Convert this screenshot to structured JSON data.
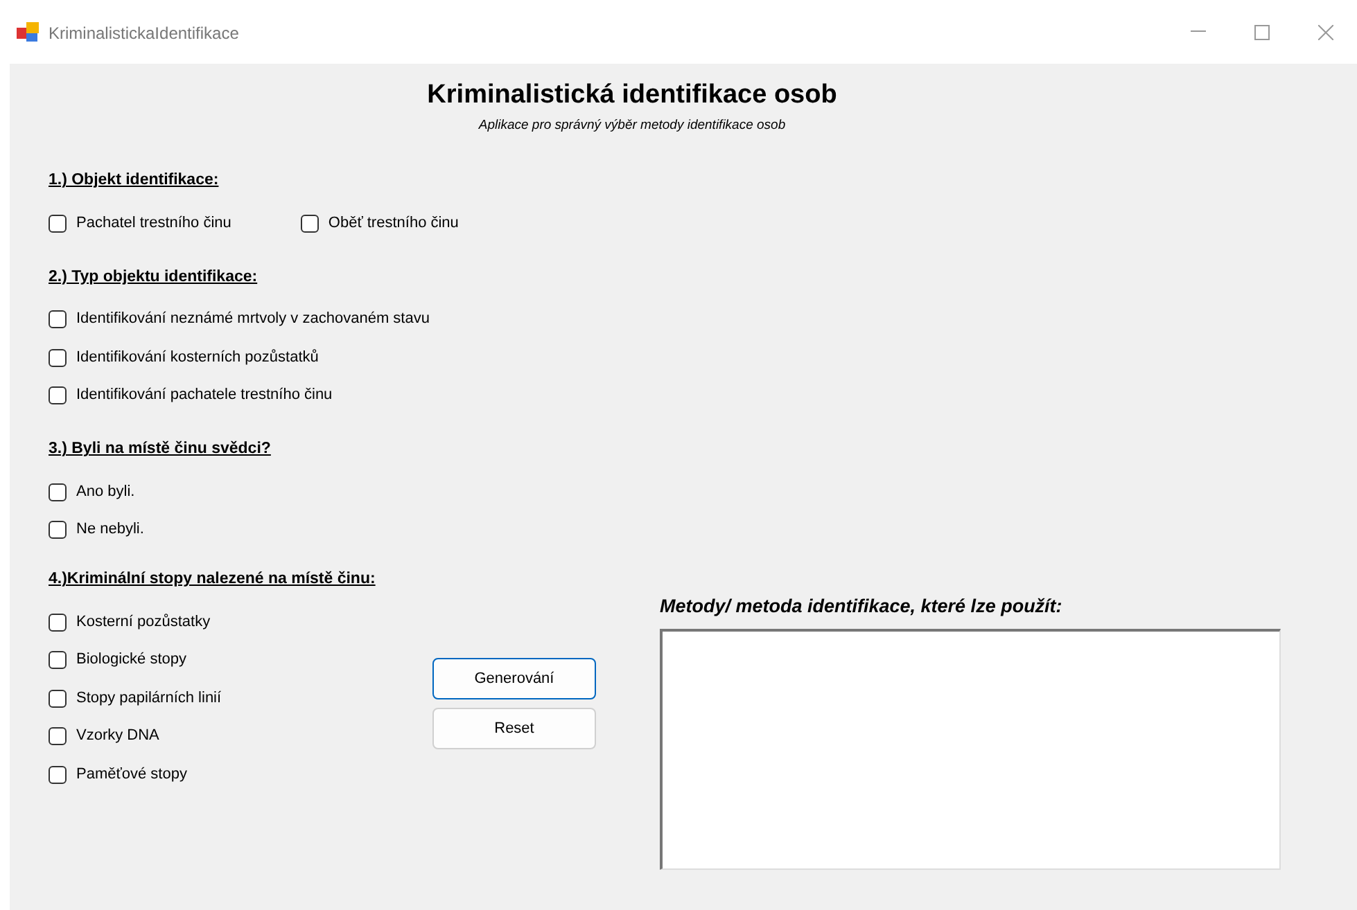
{
  "window": {
    "title": "KriminalistickaIdentifikace"
  },
  "heading": "Kriminalistická identifikace osob",
  "subtitle": "Aplikace pro správný výběr metody identifikace osob",
  "sections": [
    {
      "title": "1.) Objekt identifikace:",
      "kind": "row",
      "options": [
        {
          "label": "Pachatel trestního činu",
          "checked": false
        },
        {
          "label": "Oběť trestního činu",
          "checked": false
        }
      ]
    },
    {
      "title": "2.) Typ objektu identifikace:",
      "kind": "column",
      "options": [
        {
          "label": "Identifikování neznámé mrtvoly v zachovaném stavu",
          "checked": false
        },
        {
          "label": "Identifikování kosterních pozůstatků",
          "checked": false
        },
        {
          "label": "Identifikování pachatele trestního činu",
          "checked": false
        }
      ]
    },
    {
      "title": "3.) Byli na místě činu svědci?",
      "kind": "column",
      "options": [
        {
          "label": "Ano byli.",
          "checked": false
        },
        {
          "label": "Ne nebyli.",
          "checked": false
        }
      ]
    },
    {
      "title": "4.)Kriminální stopy nalezené na místě činu:",
      "kind": "column",
      "options": [
        {
          "label": "Kosterní pozůstatky",
          "checked": false
        },
        {
          "label": "Biologické stopy",
          "checked": false
        },
        {
          "label": "Stopy papilárních linií",
          "checked": false
        },
        {
          "label": "Vzorky DNA",
          "checked": false
        },
        {
          "label": "Paměťové stopy",
          "checked": false
        }
      ]
    }
  ],
  "buttons": [
    {
      "label": "Generování",
      "focused": true
    },
    {
      "label": "Reset",
      "focused": false
    }
  ],
  "result": {
    "label": "Metody/ metoda identifikace, které lze použít:"
  }
}
